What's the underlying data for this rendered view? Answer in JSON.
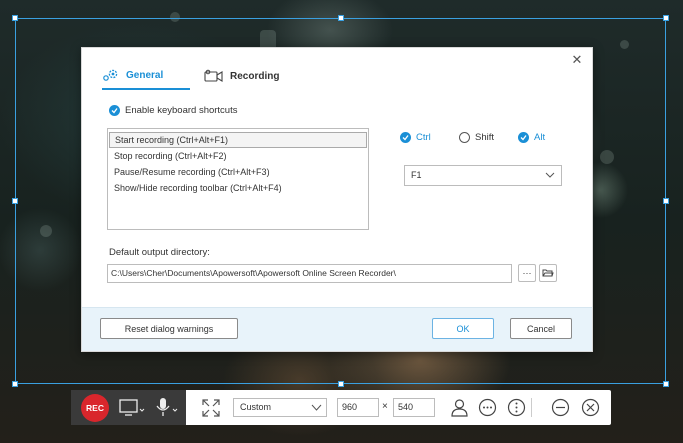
{
  "dialog": {
    "tabs": [
      {
        "label": "General",
        "active": true
      },
      {
        "label": "Recording",
        "active": false
      }
    ],
    "enable_shortcuts_label": "Enable keyboard shortcuts",
    "shortcuts": [
      "Start recording (Ctrl+Alt+F1)",
      "Stop recording (Ctrl+Alt+F2)",
      "Pause/Resume recording (Ctrl+Alt+F3)",
      "Show/Hide recording toolbar (Ctrl+Alt+F4)"
    ],
    "modifiers": {
      "ctrl": {
        "label": "Ctrl",
        "checked": true
      },
      "shift": {
        "label": "Shift",
        "checked": false
      },
      "alt": {
        "label": "Alt",
        "checked": true
      }
    },
    "key_select": "F1",
    "output_dir_label": "Default output directory:",
    "output_dir_value": "C:\\Users\\Cher\\Documents\\Apowersoft\\Apowersoft Online Screen Recorder\\",
    "browse_label": "···",
    "buttons": {
      "reset": "Reset dialog warnings",
      "ok": "OK",
      "cancel": "Cancel"
    }
  },
  "toolbar": {
    "rec_label": "REC",
    "mode": "Custom",
    "width": "960",
    "height": "540",
    "times": "×"
  },
  "colors": {
    "accent": "#1a8fd6",
    "rec": "#d9262c",
    "selection_frame": "#3aa0e0"
  }
}
